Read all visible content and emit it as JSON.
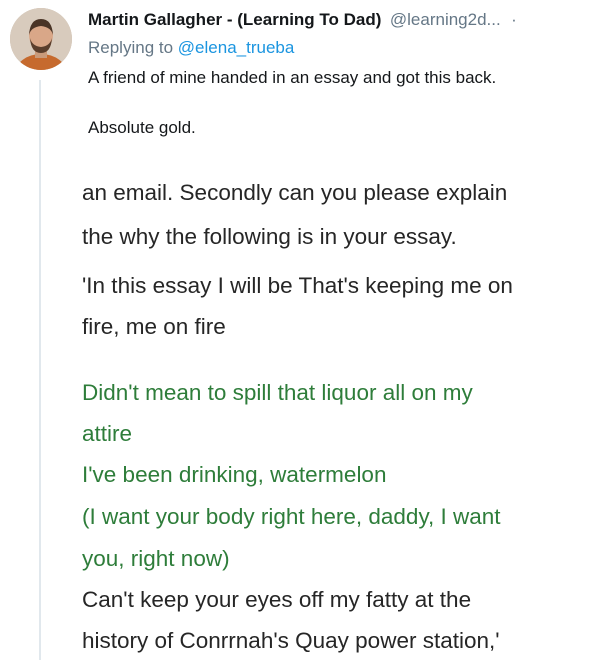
{
  "tweet": {
    "author_name": "Martin Gallagher - (Learning To Dad)",
    "author_handle": "@learning2d...",
    "more_dot": "·",
    "replying_prefix": "Replying to",
    "replying_mention": "@elena_trueba",
    "text_line1": "A friend of mine handed in an essay and got this back.",
    "text_line2": "Absolute gold."
  },
  "essay": {
    "lines": [
      {
        "text": "an email. Secondly can you please explain",
        "color": "#262626"
      },
      {
        "text": "the why the following is in your essay.",
        "color": "#262626"
      },
      {
        "text": " 'In this essay I will be That's keeping me on",
        "color": "#262626"
      },
      {
        "text": "fire, me on fire",
        "color": "#262626"
      },
      {
        "text": "Didn't mean to spill that liquor all on my",
        "color": "#2e7d3a"
      },
      {
        "text": "attire",
        "color": "#2e7d3a"
      },
      {
        "text": "I've been drinking, watermelon",
        "color": "#2e7d3a"
      },
      {
        "text": "(I want your body right here, daddy, I want",
        "color": "#2e7d3a"
      },
      {
        "text": "you, right now)",
        "color": "#2e7d3a"
      },
      {
        "text": "Can't keep your eyes off my fatty at the",
        "color": "#262626"
      },
      {
        "text": "history of Conrrnah's Quay power station,'",
        "color": "#262626"
      }
    ]
  }
}
